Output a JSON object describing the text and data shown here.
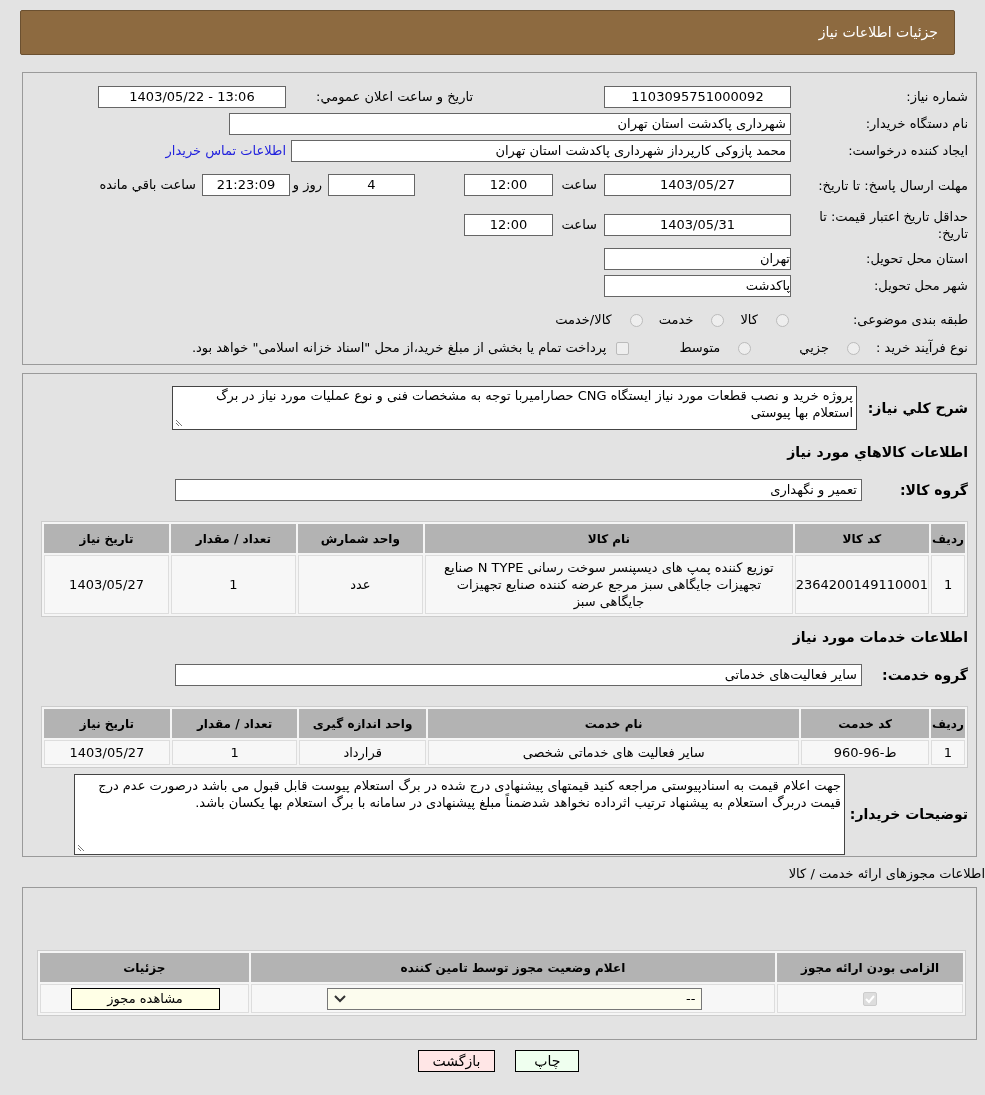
{
  "header": {
    "title": "جزئیات اطلاعات نیاز"
  },
  "need_number": {
    "label": "شماره نیاز:",
    "value": "1103095751000092"
  },
  "announce": {
    "label": "تاریخ و ساعت اعلان عمومي:",
    "value": "1403/05/22 - 13:06"
  },
  "buyer_org": {
    "label": "نام دستگاه خریدار:",
    "value": "شهرداری پاکدشت استان تهران"
  },
  "requester": {
    "label": "ایجاد کننده درخواست:",
    "value": "محمد پازوکی کارپرداز شهرداری پاکدشت استان تهران",
    "link": "اطلاعات تماس خریدار"
  },
  "reply_deadline": {
    "label": "مهلت ارسال پاسخ: تا تاریخ:",
    "date": "1403/05/27",
    "time_label": "ساعت",
    "time": "12:00",
    "days": "4",
    "days_label": "روز و",
    "remaining": "21:23:09",
    "remaining_label": "ساعت باقي مانده"
  },
  "price_validity": {
    "label": "حداقل تاریخ اعتبار قیمت: تا تاریخ:",
    "date": "1403/05/31",
    "time_label": "ساعت",
    "time": "12:00"
  },
  "province": {
    "label": "استان محل تحویل:",
    "value": "تهران"
  },
  "city": {
    "label": "شهر محل تحویل:",
    "value": "پاکدشت"
  },
  "category": {
    "label": "طبقه بندی موضوعی:",
    "options": [
      {
        "label": "کالا",
        "selected": false
      },
      {
        "label": "خدمت",
        "selected": false
      },
      {
        "label": "کالا/خدمت",
        "selected": false
      }
    ]
  },
  "purchase_type": {
    "label": "نوع فرآیند خرید :",
    "options": [
      {
        "label": "جزيي",
        "selected": false
      },
      {
        "label": "متوسط",
        "selected": false
      }
    ],
    "note": "پرداخت تمام یا بخشی از مبلغ خرید،از محل \"اسناد خزانه اسلامی\" خواهد بود.",
    "note_checked": false
  },
  "description": {
    "label": "شرح كلي نياز:",
    "value": "پروژه خرید و نصب قطعات مورد نیاز ایستگاه CNG حصارامیربا توجه به مشخصات فنی و نوع عملیات مورد نیاز در برگ استعلام بها پیوستی"
  },
  "goods": {
    "title": "اطلاعات كالاهاي مورد نياز",
    "group_label": "گروه کالا:",
    "group": "تعمیر و نگهداری",
    "columns": [
      "ردیف",
      "کد کالا",
      "نام کالا",
      "واحد شمارش",
      "تعداد / مقدار",
      "تاریخ نیاز"
    ],
    "rows": [
      [
        "1",
        "2364200149110001",
        "توزیع کننده پمپ های دیسپنسر سوخت رسانی N TYPE صنایع تجهیزات جایگاهی سبز مرجع عرضه کننده صنایع تجهیزات جایگاهی سبز",
        "عدد",
        "1",
        "1403/05/27"
      ]
    ]
  },
  "services": {
    "title": "اطلاعات خدمات مورد نیاز",
    "group_label": "گروه خدمت:",
    "group": "سایر فعالیت‌های خدماتی",
    "columns": [
      "ردیف",
      "کد خدمت",
      "نام خدمت",
      "واحد اندازه گیری",
      "تعداد / مقدار",
      "تاریخ نیاز"
    ],
    "rows": [
      [
        "1",
        "ط-96-960",
        "سایر فعالیت های خدماتی شخصی",
        "قرارداد",
        "1",
        "1403/05/27"
      ]
    ]
  },
  "buyer_notes": {
    "label": "توضیحات خریدار:",
    "value": "جهت اعلام قیمت به اسنادپیوستی مراجعه کنید قیمتهای پیشنهادی درج شده در برگ استعلام پیوست قابل قبول می باشد درصورت عدم درج قیمت دربرگ استعلام به پیشنهاد ترتیب اثرداده نخواهد شدضمناً مبلغ پیشنهادی در سامانه با برگ استعلام بها یکسان باشد."
  },
  "permits": {
    "title": "اطلاعات مجوزهای ارائه خدمت / کالا",
    "columns": [
      "الزامی بودن ارائه مجوز",
      "اعلام وضعیت مجوز توسط تامین کننده",
      "جزئیات"
    ],
    "rows": [
      {
        "required": true,
        "status": "--",
        "action": "مشاهده مجوز"
      }
    ]
  },
  "buttons": [
    {
      "label": "چاپ",
      "kind": "print"
    },
    {
      "label": "بازگشت",
      "kind": "back"
    }
  ]
}
